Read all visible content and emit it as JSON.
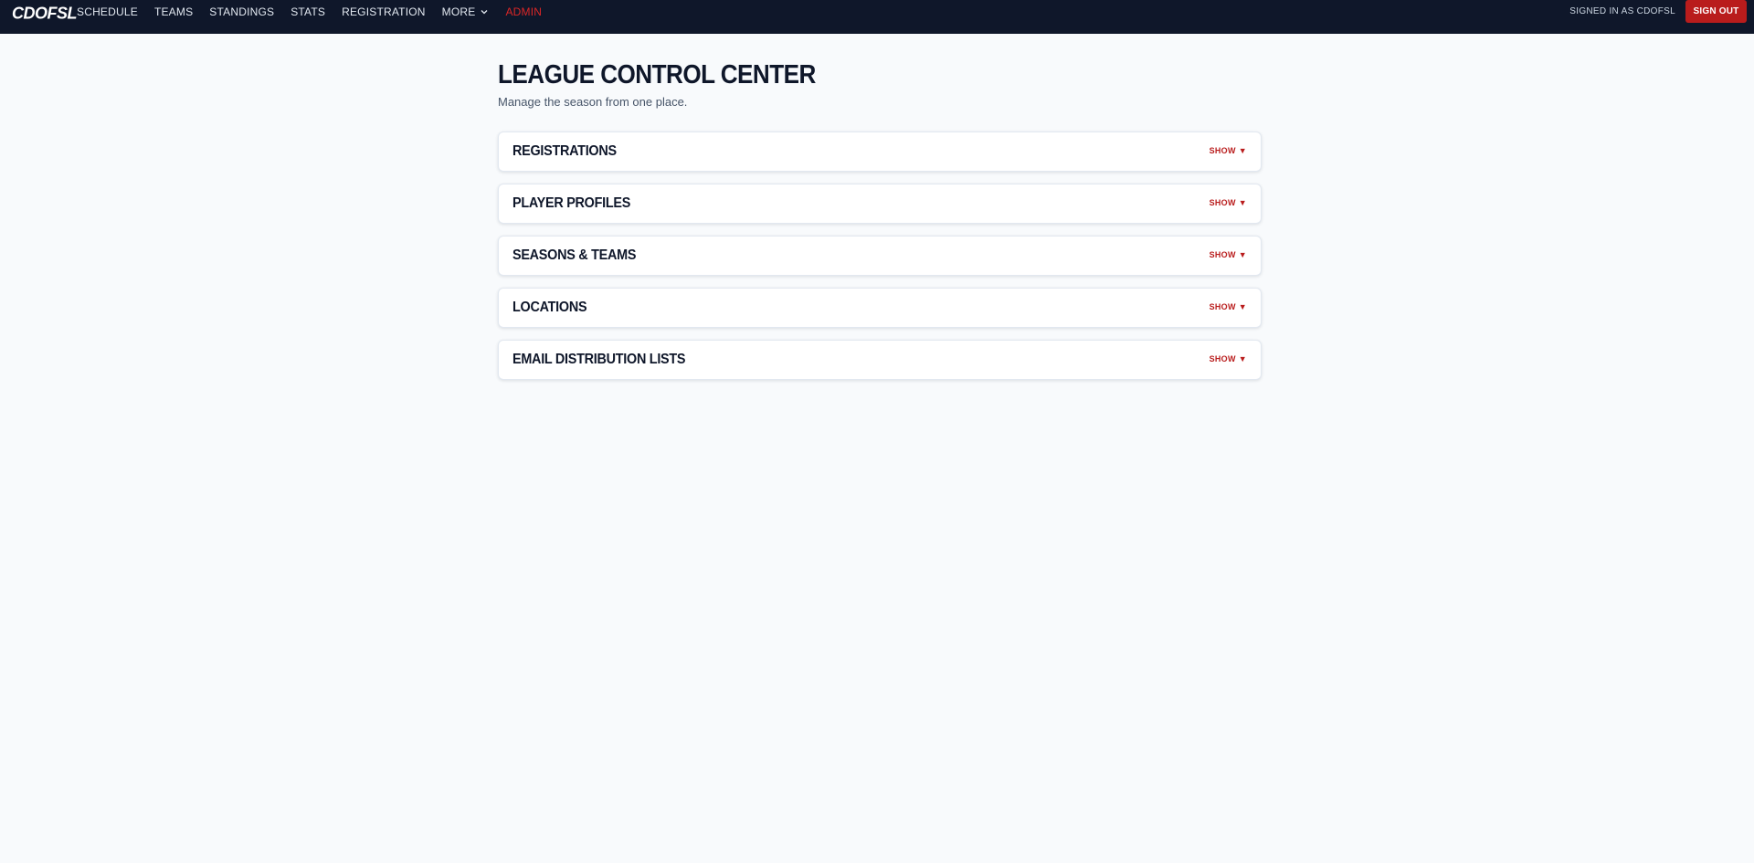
{
  "brand": {
    "logo_text": "CDOFSL"
  },
  "nav": {
    "items": [
      {
        "label": "SCHEDULE"
      },
      {
        "label": "TEAMS"
      },
      {
        "label": "STANDINGS"
      },
      {
        "label": "STATS"
      },
      {
        "label": "REGISTRATION"
      },
      {
        "label": "MORE"
      },
      {
        "label": "ADMIN"
      }
    ]
  },
  "account": {
    "signed_in_text": "SIGNED IN AS CDOFSL",
    "sign_out_label": "SIGN OUT"
  },
  "page": {
    "title": "LEAGUE CONTROL CENTER",
    "subtitle": "Manage the season from one place."
  },
  "panels": [
    {
      "title": "REGISTRATIONS",
      "toggle": "SHOW"
    },
    {
      "title": "PLAYER PROFILES",
      "toggle": "SHOW"
    },
    {
      "title": "SEASONS & TEAMS",
      "toggle": "SHOW"
    },
    {
      "title": "LOCATIONS",
      "toggle": "SHOW"
    },
    {
      "title": "EMAIL DISTRIBUTION LISTS",
      "toggle": "SHOW"
    }
  ],
  "icons": {
    "more_dropdown": "chevron-down-icon",
    "panel_toggle": "triangle-down-icon"
  },
  "colors": {
    "nav_background": "#0f172a",
    "accent_red": "#b91c1c",
    "admin_red": "#dc2626",
    "page_background": "#f8fafc"
  }
}
